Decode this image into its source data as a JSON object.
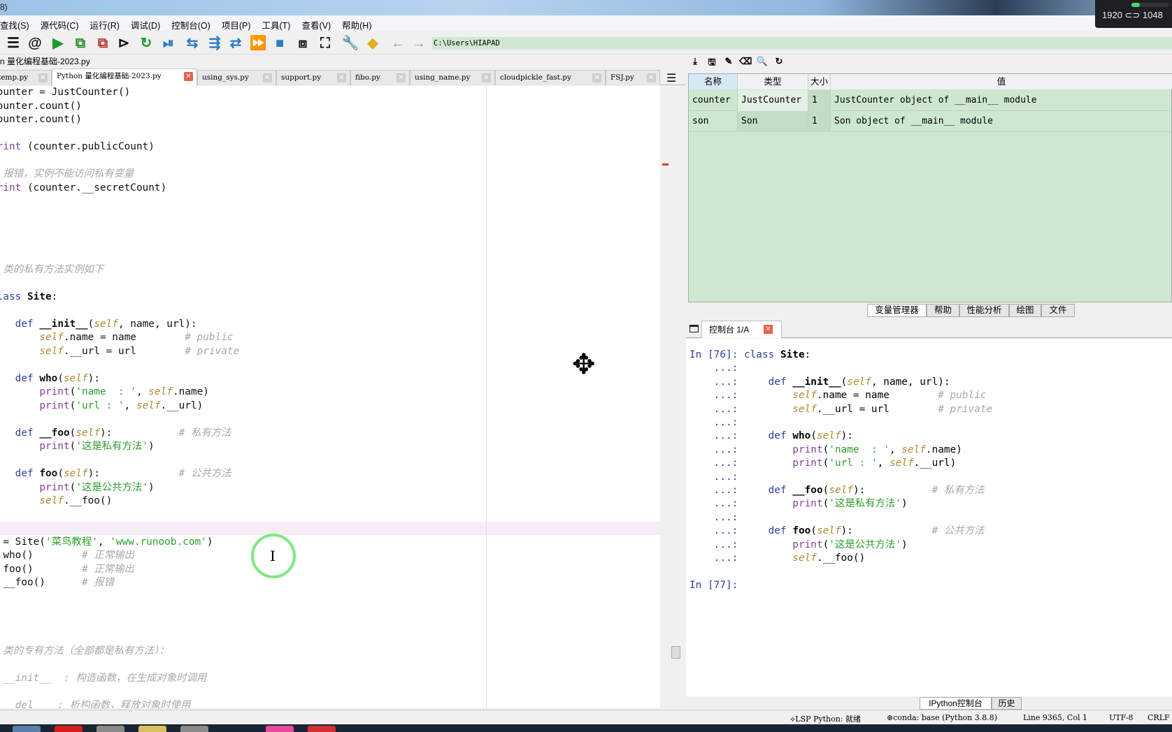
{
  "window": {
    "title_fragment": "8)"
  },
  "resolution_overlay": {
    "text": "1920 ⊂⊃ 1048"
  },
  "menu": [
    "查找(S)",
    "源代码(C)",
    "运行(R)",
    "调试(D)",
    "控制台(O)",
    "项目(P)",
    "工具(T)",
    "查看(V)",
    "帮助(H)"
  ],
  "toolbar": {
    "icons": [
      {
        "name": "outline-icon",
        "glyph": "☰",
        "color": "#111"
      },
      {
        "name": "at-icon",
        "glyph": "@",
        "color": "#111"
      },
      {
        "name": "run-icon",
        "glyph": "▶",
        "color": "#1a9a2a"
      },
      {
        "name": "run-cell-icon",
        "glyph": "⧉",
        "color": "#2a8a2a"
      },
      {
        "name": "run-cell-advance-icon",
        "glyph": "⧉",
        "color": "#c0302a"
      },
      {
        "name": "run-selection-icon",
        "glyph": "⊳",
        "color": "#111"
      },
      {
        "name": "rerun-icon",
        "glyph": "↻",
        "color": "#1a9a2a"
      },
      {
        "name": "debug-icon",
        "glyph": "⏯",
        "color": "#2a7ac8"
      },
      {
        "name": "step-icon",
        "glyph": "⇆",
        "color": "#2a7ac8"
      },
      {
        "name": "step-into-icon",
        "glyph": "⇶",
        "color": "#2a7ac8"
      },
      {
        "name": "step-return-icon",
        "glyph": "⇄",
        "color": "#2a7ac8"
      },
      {
        "name": "continue-icon",
        "glyph": "⏩",
        "color": "#2a7ac8"
      },
      {
        "name": "stop-icon",
        "glyph": "■",
        "color": "#2a7ac8"
      },
      {
        "name": "maximize-pane-icon",
        "glyph": "⧈",
        "color": "#111"
      },
      {
        "name": "fullscreen-icon",
        "glyph": "⛶",
        "color": "#111"
      },
      {
        "name": "wrench-icon",
        "glyph": "🔧",
        "color": "#111"
      },
      {
        "name": "python-icon",
        "glyph": "◆",
        "color": "#e0b020"
      },
      {
        "name": "back-arrow-icon",
        "glyph": "←",
        "color": "#999"
      },
      {
        "name": "forward-arrow-icon",
        "glyph": "→",
        "color": "#999"
      }
    ],
    "path": "C:\\Users\\HIAPAD"
  },
  "editor": {
    "filename": "n 量化编程基础-2023.py",
    "tabs": [
      {
        "label": "temp.py",
        "active": false
      },
      {
        "label": "Python 量化编程基础-2023.py",
        "active": true
      },
      {
        "label": "using_sys.py",
        "active": false
      },
      {
        "label": "support.py",
        "active": false
      },
      {
        "label": "fibo.py",
        "active": false
      },
      {
        "label": "using_name.py",
        "active": false
      },
      {
        "label": "cloudpickle_fast.py",
        "active": false
      },
      {
        "label": "FSJ.py",
        "active": false
      }
    ],
    "current_line_index": 32,
    "lines": [
      "counter = JustCounter()",
      "counter.count()",
      "counter.count()",
      "",
      "print (counter.publicCount)",
      "",
      "# 报错，实例不能访问私有变量",
      "print (counter.__secretCount)",
      "",
      "",
      "",
      "",
      "",
      "# 类的私有方法实例如下",
      "",
      "class Site:",
      "",
      "    def __init__(self, name, url):",
      "        self.name = name        # public",
      "        self.__url = url        # private",
      "",
      "    def who(self):",
      "        print('name  : ', self.name)",
      "        print('url : ', self.__url)",
      "",
      "    def __foo(self):           # 私有方法",
      "        print('这是私有方法')",
      "",
      "    def foo(self):             # 公共方法",
      "        print('这是公共方法')",
      "        self.__foo()",
      "",
      "",
      "  = Site('菜鸟教程', 'www.runoob.com')",
      "  who()        # 正常输出",
      "  foo()        # 正常输出",
      "  __foo()      # 报错",
      "",
      "",
      "",
      "",
      "# 类的专有方法（全部都是私有方法）：",
      "",
      "# __init__  : 构造函数，在生成对象时调用",
      "",
      "#   del    : 析构函数，释放对象时使用"
    ]
  },
  "variable_explorer": {
    "toolbar": [
      {
        "name": "import-data-icon",
        "glyph": "⤓"
      },
      {
        "name": "save-data-icon",
        "glyph": "🖫"
      },
      {
        "name": "save-as-icon",
        "glyph": "✎"
      },
      {
        "name": "eraser-icon",
        "glyph": "⌫"
      },
      {
        "name": "search-icon",
        "glyph": "🔍"
      },
      {
        "name": "refresh-icon",
        "glyph": "↻"
      }
    ],
    "columns": [
      "名称",
      "类型",
      "大小",
      "值"
    ],
    "rows": [
      {
        "name": "counter",
        "type": "JustCounter",
        "size": "1",
        "value": "JustCounter object of __main__ module"
      },
      {
        "name": "son",
        "type": "Son",
        "size": "1",
        "value": "Son object of __main__ module"
      }
    ],
    "background_color": "#cde8cf"
  },
  "pane_tabs": [
    {
      "label": "变量管理器",
      "active": true
    },
    {
      "label": "帮助",
      "active": false
    },
    {
      "label": "性能分析",
      "active": false
    },
    {
      "label": "绘图",
      "active": false
    },
    {
      "label": "文件",
      "active": false
    }
  ],
  "console": {
    "tab_label": "控制台 1/A",
    "lines": [
      {
        "prompt": "In [76]: ",
        "code": "class Site:"
      },
      {
        "prompt": "    ...: ",
        "code": ""
      },
      {
        "prompt": "    ...: ",
        "code": "    def __init__(self, name, url):"
      },
      {
        "prompt": "    ...: ",
        "code": "        self.name = name        # public"
      },
      {
        "prompt": "    ...: ",
        "code": "        self.__url = url        # private"
      },
      {
        "prompt": "    ...: ",
        "code": ""
      },
      {
        "prompt": "    ...: ",
        "code": "    def who(self):"
      },
      {
        "prompt": "    ...: ",
        "code": "        print('name  : ', self.name)"
      },
      {
        "prompt": "    ...: ",
        "code": "        print('url : ', self.__url)"
      },
      {
        "prompt": "    ...: ",
        "code": ""
      },
      {
        "prompt": "    ...: ",
        "code": "    def __foo(self):           # 私有方法"
      },
      {
        "prompt": "    ...: ",
        "code": "        print('这是私有方法')"
      },
      {
        "prompt": "    ...: ",
        "code": ""
      },
      {
        "prompt": "    ...: ",
        "code": "    def foo(self):             # 公共方法"
      },
      {
        "prompt": "    ...: ",
        "code": "        print('这是公共方法')"
      },
      {
        "prompt": "    ...: ",
        "code": "        self.__foo()"
      },
      {
        "prompt": "",
        "code": ""
      },
      {
        "prompt": "In [77]: ",
        "code": ""
      }
    ]
  },
  "bottom_tabs": [
    {
      "label": "IPython控制台",
      "active": true
    },
    {
      "label": "历史",
      "active": false
    }
  ],
  "status": {
    "lsp": "LSP Python: 就绪",
    "conda": "conda: base (Python 3.8.8)",
    "position": "Line 9365, Col 1",
    "encoding": "UTF-8",
    "eol": "CRLF"
  }
}
